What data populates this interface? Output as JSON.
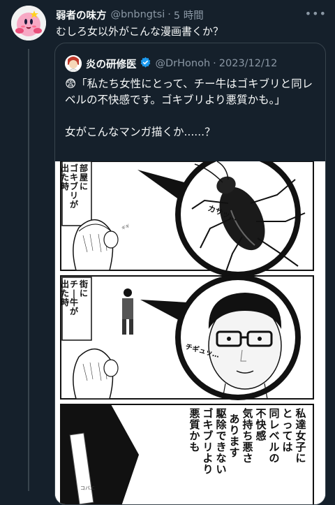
{
  "reply": {
    "display_name": "弱者の味方",
    "handle": "@bnbngtsi",
    "separator": "·",
    "time": "5 時間",
    "text": "むしろ女以外がこんな漫画書くか？",
    "avatar_icon": "kirby-avatar-icon"
  },
  "quote": {
    "display_name": "炎の研修医",
    "handle": "@DrHonoh",
    "separator": "·",
    "date": "2023/12/12",
    "emoji": "😨",
    "line1": "「私たち女性にとって、チー牛はゴキブリと同レベルの不快感です。ゴキブリより悪質かも。」",
    "line2": "女がこんなマンガ描くか......？"
  },
  "manga": {
    "panel1_caption": [
      "部屋に",
      "ゴキブリが",
      "出た時"
    ],
    "panel1_sfx": "カサッ…",
    "panel2_caption": [
      "街に",
      "チー牛が",
      "出た時"
    ],
    "panel2_sfx": "チギュッ…",
    "panel3_text": [
      "私達女子に",
      "とっては",
      "同レベルの",
      "不快感",
      "気持ち悪さ",
      "あります",
      "駆除できない",
      "ゴキブリより",
      "悪質かも"
    ],
    "small_label": "コバエ"
  },
  "colors": {
    "background": "#15202b",
    "text": "#f7f9f9",
    "muted": "#8b98a5",
    "border": "#38444d",
    "verified": "#1d9bf0"
  }
}
